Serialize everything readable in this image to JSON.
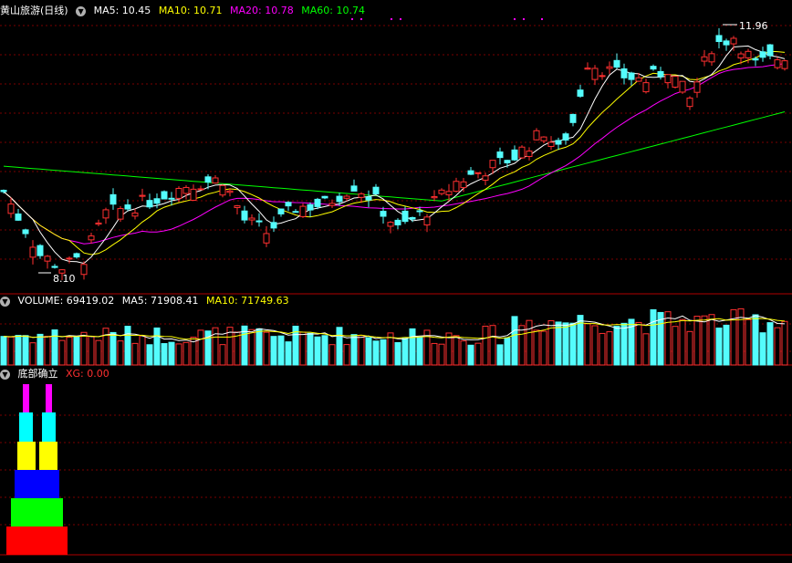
{
  "main_panel": {
    "title": "黄山旅游(日线)",
    "ma_labels": [
      {
        "text": "MA5: 10.45",
        "color": "#ffffff"
      },
      {
        "text": "MA10: 10.71",
        "color": "#ffff00"
      },
      {
        "text": "MA20: 10.78",
        "color": "#ff00ff"
      },
      {
        "text": "MA60: 10.74",
        "color": "#00ff00"
      }
    ],
    "high_label": "11.96",
    "low_label": "8.10"
  },
  "volume_panel": {
    "labels": [
      {
        "text": "VOLUME: 69419.02",
        "color": "#ffffff"
      },
      {
        "text": "MA5: 71908.41",
        "color": "#ffffff"
      },
      {
        "text": "MA10: 71749.63",
        "color": "#ffff00"
      }
    ]
  },
  "indicator_panel": {
    "title": "底部确立",
    "value_label": "XG: 0.00",
    "value_color": "#ff3030",
    "stack_colors": [
      "#ff0000",
      "#00ff00",
      "#0000ff",
      "#ffff00",
      "#00ffff",
      "#ff00ff"
    ]
  },
  "colors": {
    "up": "#ff3030",
    "down": "#54fcfc",
    "grid": "#7a0000",
    "separator": "#b00000",
    "ma5": "#ffffff",
    "ma10": "#ffff00",
    "ma20": "#ff00ff",
    "ma60": "#00ff00"
  },
  "chart_data": {
    "type": "candlestick",
    "price_high": 11.96,
    "price_low": 8.1,
    "ma_current": {
      "MA5": 10.45,
      "MA10": 10.71,
      "MA20": 10.78,
      "MA60": 10.74
    },
    "volume_current": {
      "VOLUME": 69419.02,
      "MA5": 71908.41,
      "MA10": 71749.63
    },
    "indicator_current": {
      "XG": 0.0
    }
  }
}
